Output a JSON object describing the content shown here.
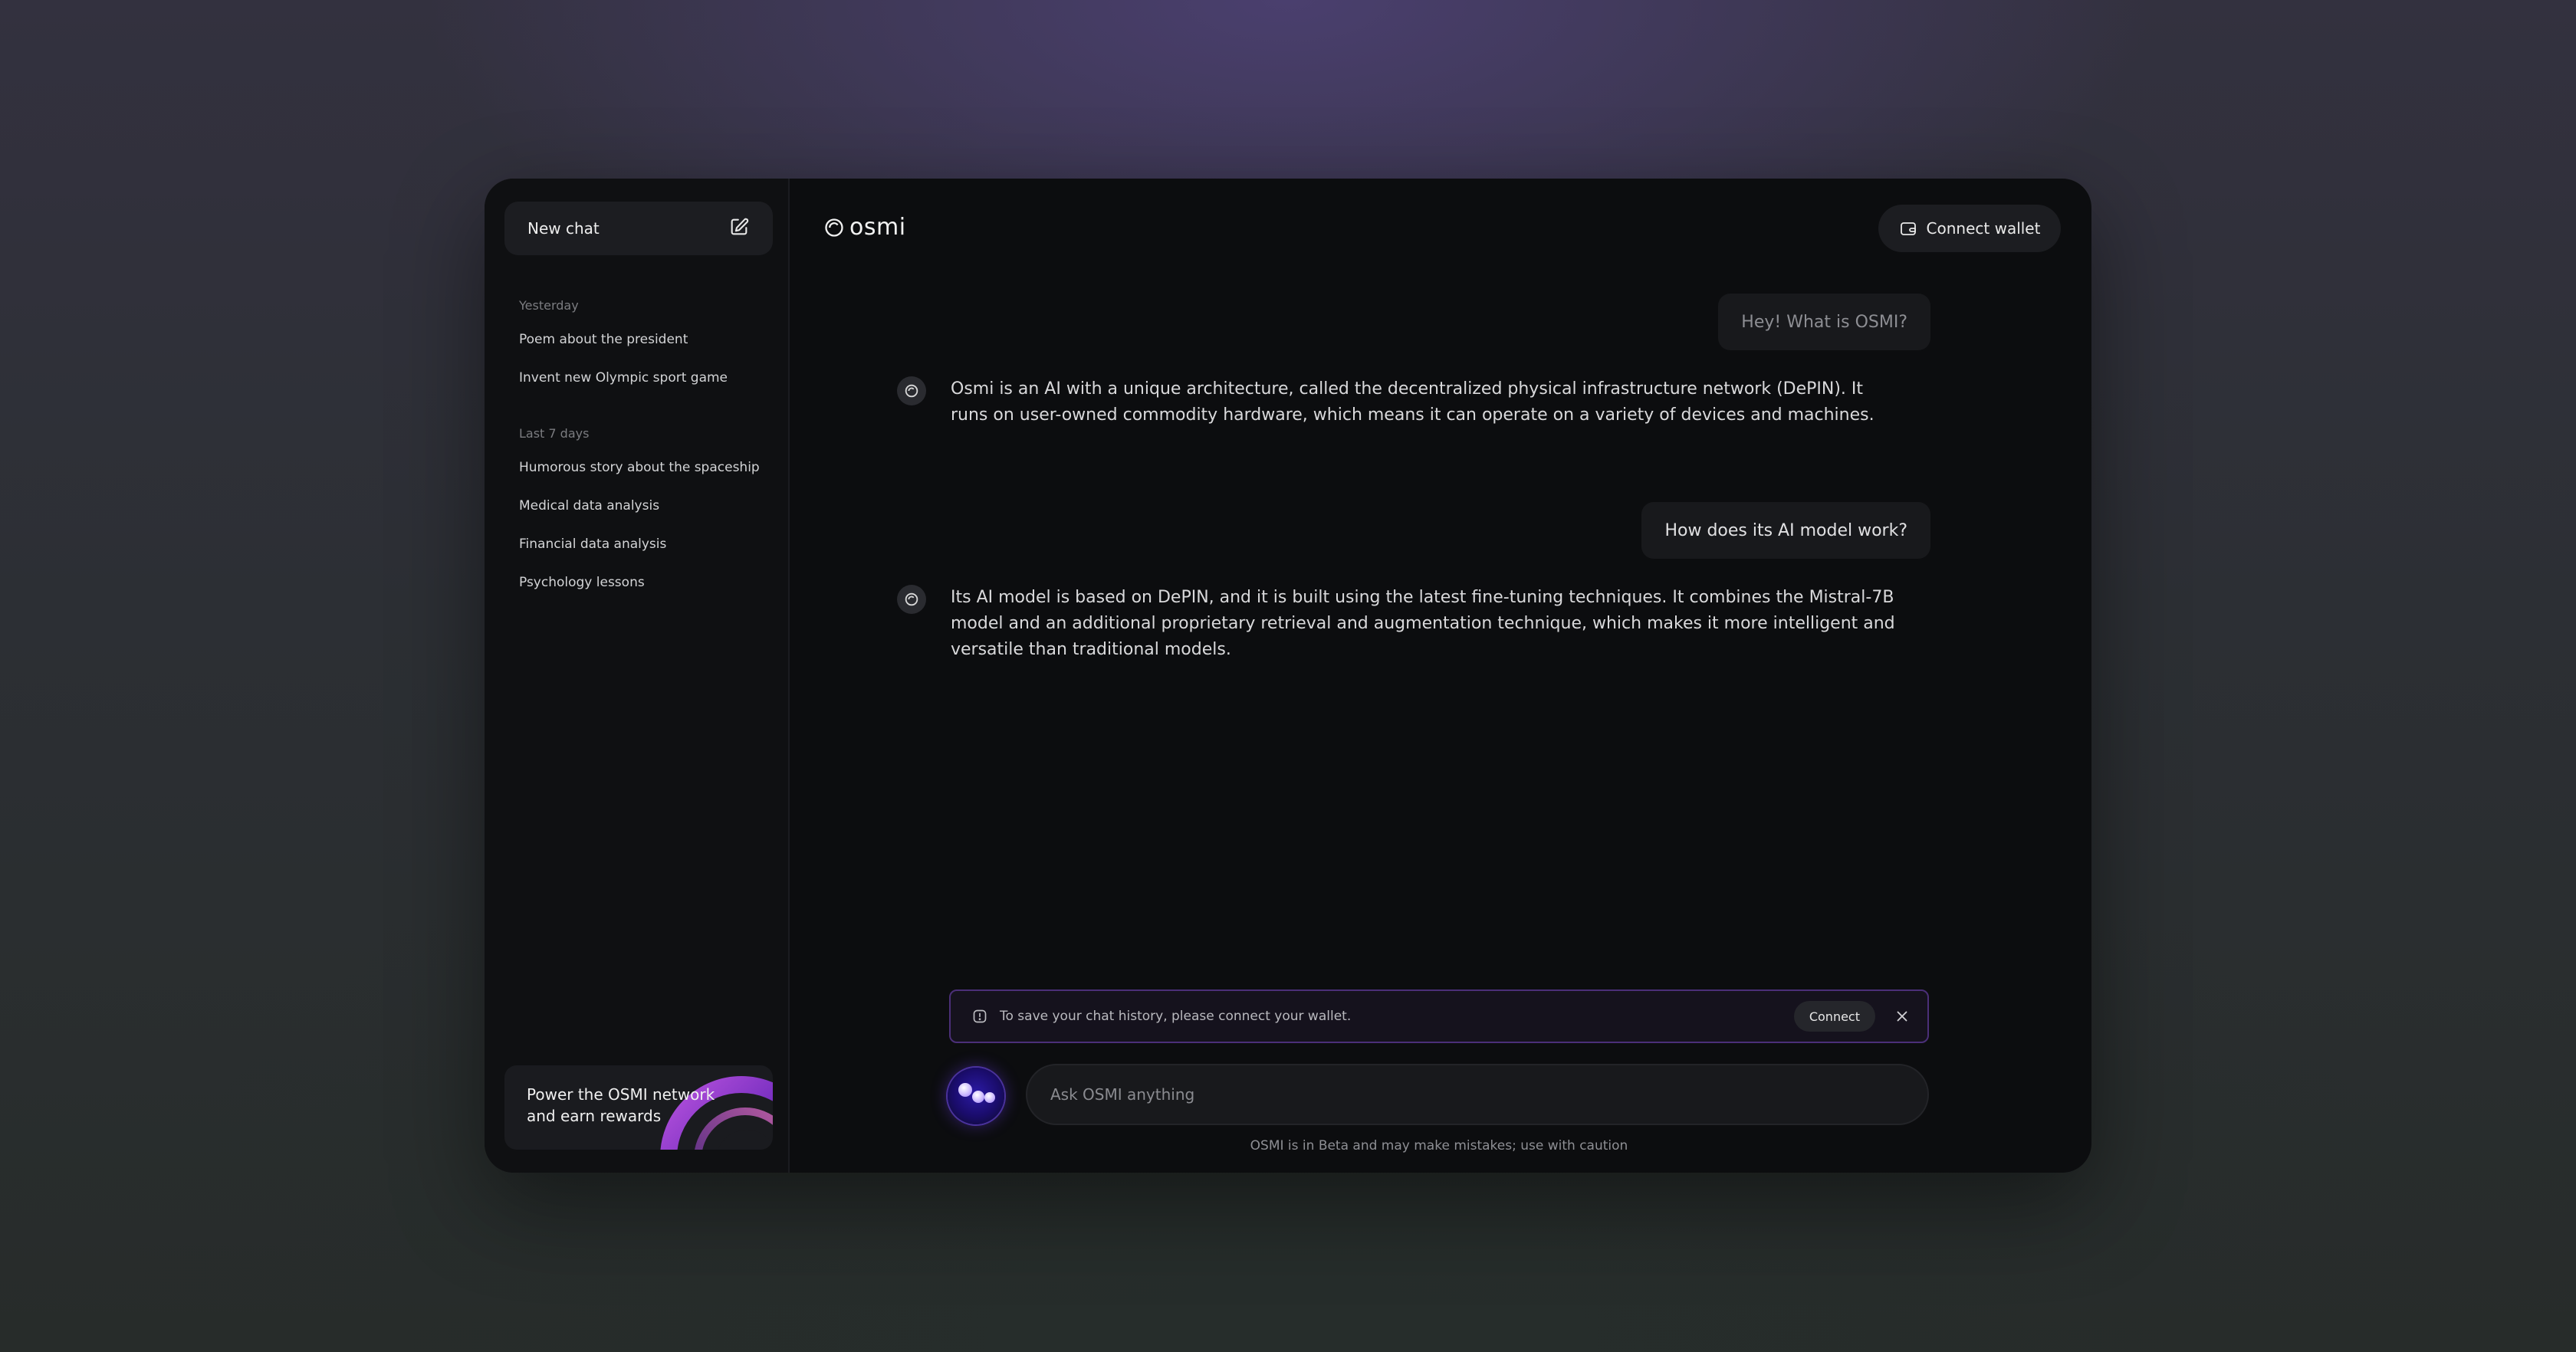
{
  "sidebar": {
    "new_chat_label": "New chat",
    "groups": [
      {
        "label": "Yesterday",
        "items": [
          "Poem about the president",
          "Invent new Olympic sport game"
        ]
      },
      {
        "label": "Last 7 days",
        "items": [
          "Humorous story about the spaceship",
          "Medical data analysis",
          "Financial data analysis",
          "Psychology lessons"
        ]
      }
    ],
    "promo_text": "Power the OSMI network and earn rewards"
  },
  "header": {
    "logo_text": "osmi",
    "connect_wallet_label": "Connect wallet"
  },
  "messages": [
    {
      "role": "user",
      "text": "Hey! What is OSMI?"
    },
    {
      "role": "ai",
      "text": "Osmi is an AI with a unique architecture, called the decentralized physical infrastructure network (DePIN). It runs on user-owned commodity hardware, which means it can operate on a variety of devices and machines."
    },
    {
      "role": "user",
      "text": "How does its AI model work?"
    },
    {
      "role": "ai",
      "text": "Its AI model is based on DePIN, and it is built using the latest fine-tuning techniques. It combines the Mistral-7B model and an additional proprietary retrieval and augmentation technique, which makes it more intelligent and versatile than traditional models."
    }
  ],
  "notice": {
    "text": "To save your chat history, please connect your wallet.",
    "connect_label": "Connect"
  },
  "composer": {
    "placeholder": "Ask OSMI anything",
    "disclaimer": "OSMI is in Beta and may make mistakes; use with caution"
  },
  "colors": {
    "accent_purple": "#4b2f78",
    "panel_bg": "#0c0d0f",
    "sidebar_bg": "#0f1012"
  }
}
